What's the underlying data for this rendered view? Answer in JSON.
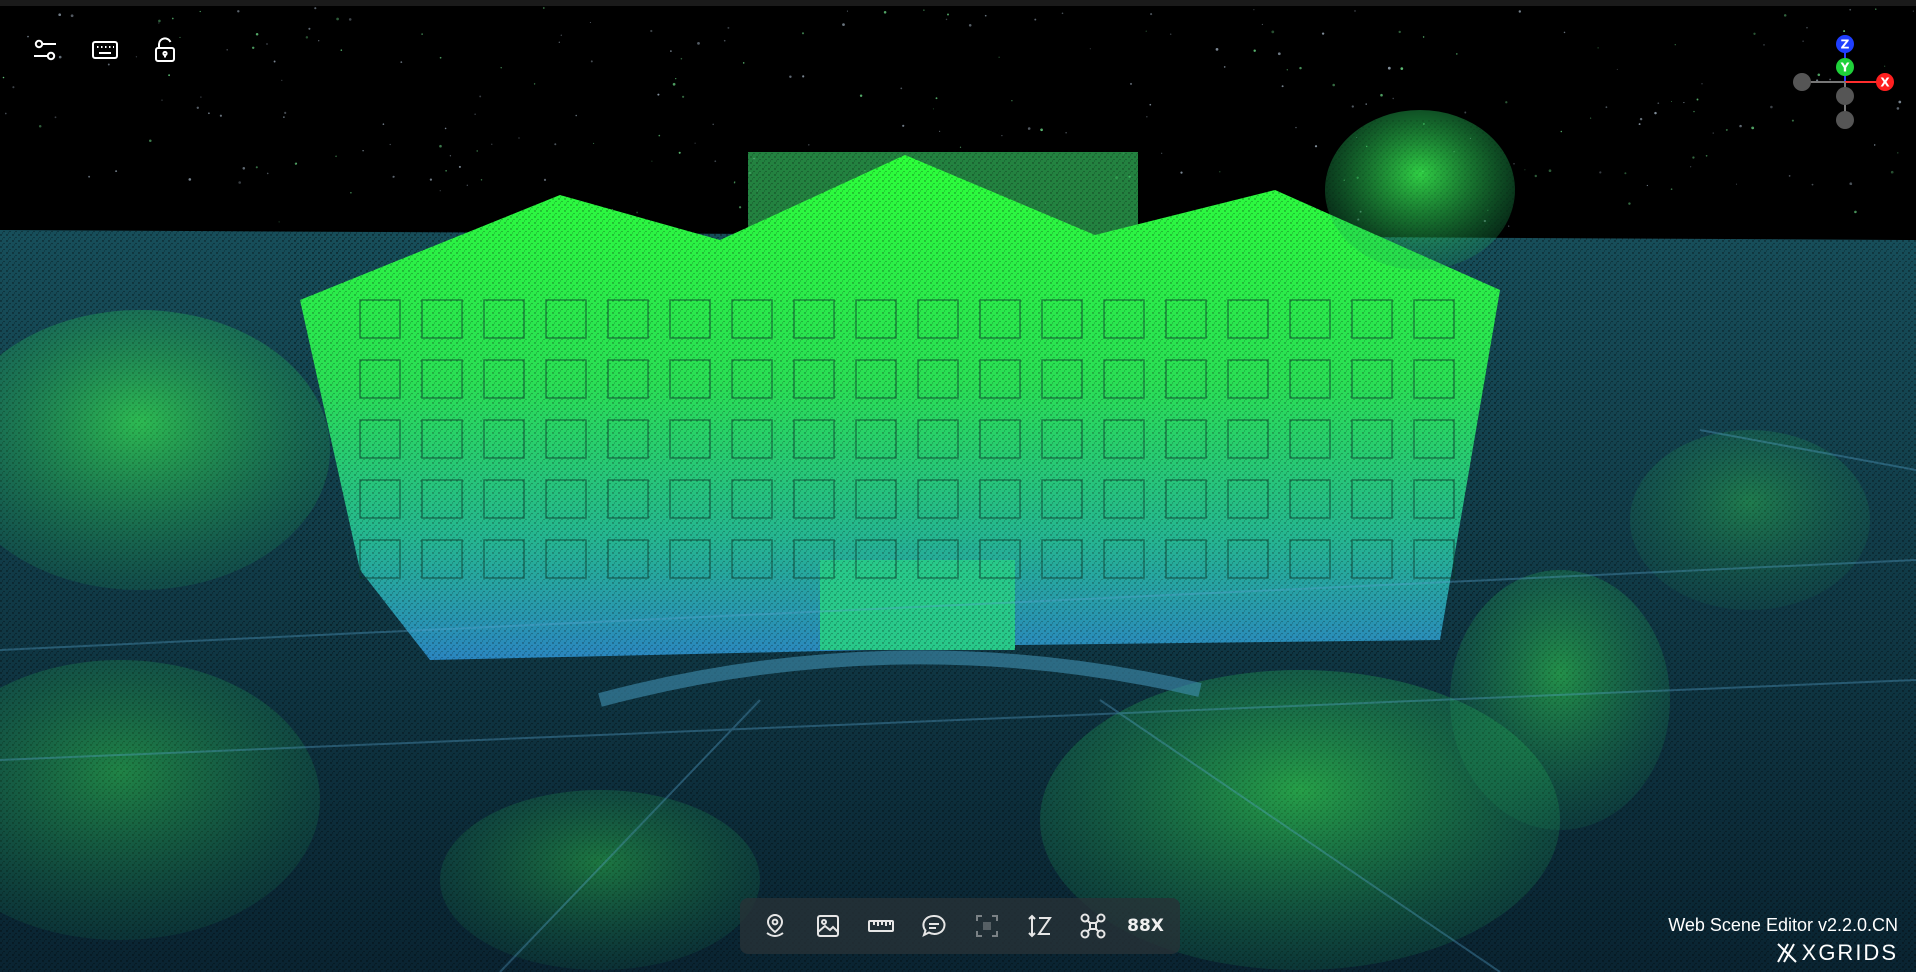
{
  "top_left_tools": [
    {
      "id": "settings",
      "icon": "sliders-icon"
    },
    {
      "id": "keyboard",
      "icon": "keyboard-icon"
    },
    {
      "id": "lock",
      "icon": "unlock-icon"
    }
  ],
  "gizmo": {
    "z_label": "Z",
    "y_label": "Y",
    "x_label": "X",
    "z_color": "#1f3fff",
    "y_color": "#1fd13a",
    "x_color": "#ff1f1f"
  },
  "toolbar": {
    "items": [
      {
        "id": "location",
        "icon": "location-pin-icon"
      },
      {
        "id": "image",
        "icon": "image-icon"
      },
      {
        "id": "measure",
        "icon": "ruler-icon"
      },
      {
        "id": "annotate",
        "icon": "comment-icon"
      },
      {
        "id": "focus",
        "icon": "focus-frame-icon"
      },
      {
        "id": "height",
        "icon": "height-z-icon"
      },
      {
        "id": "drone",
        "icon": "drone-icon"
      }
    ],
    "speed_label": "88X"
  },
  "footer": {
    "version": "Web Scene Editor v2.2.0.CN",
    "brand": "XGRIDS"
  },
  "colors": {
    "background": "#000000",
    "point_high": "#2cff3a",
    "point_mid": "#22c38a",
    "point_low": "#2a7fbf",
    "toolbar_bg": "#28323700"
  }
}
